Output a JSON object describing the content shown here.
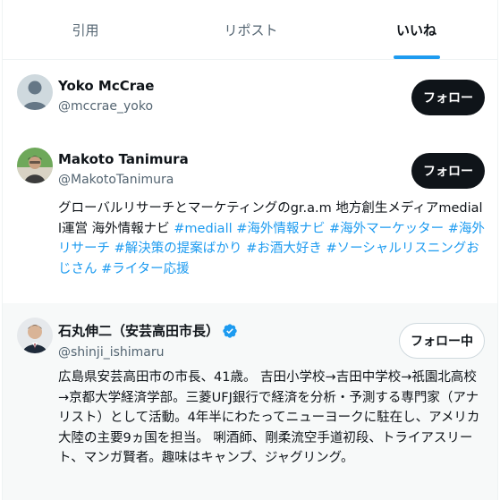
{
  "tabs": [
    {
      "label": "引用"
    },
    {
      "label": "リポスト"
    },
    {
      "label": "いいね"
    }
  ],
  "users": [
    {
      "name": "Yoko McCrae",
      "handle": "@mccrae_yoko",
      "button": "フォロー"
    },
    {
      "name": "Makoto Tanimura",
      "handle": "@MakotoTanimura",
      "button": "フォロー",
      "bio_text": "グローバルリサーチとマーケティングのgr.a.m 地方創生メディアmediall運営 海外情報ナビ ",
      "bio_tags": [
        "#mediall",
        "#海外情報ナビ",
        "#海外マーケッター",
        "#海外リサーチ",
        "#解決策の提案ばかり",
        "#お酒大好き",
        "#ソーシャルリスニングおじさん",
        "#ライター応援"
      ]
    },
    {
      "name": "石丸伸二（安芸高田市長）",
      "handle": "@shinji_ishimaru",
      "button": "フォロー中",
      "bio_text": "広島県安芸高田市の市長、41歳。 吉田小学校→吉田中学校→祇園北高校→京都大学経済学部。三菱UFJ銀行で経済を分析・予測する専門家（アナリスト）として活動。4年半にわたってニューヨークに駐在し、アメリカ大陸の主要9ヵ国を担当。 唎酒師、剛柔流空手道初段、トライアスリート、マンガ賢者。趣味はキャンプ、ジャグリング。"
    }
  ],
  "colors": {
    "accent": "#1d9bf0",
    "text": "#0f1419",
    "secondary": "#536471",
    "highlight_bg": "#f7f9f9"
  },
  "icons": {
    "verified": "verified-badge-icon",
    "default_avatar": "default-avatar-icon"
  }
}
